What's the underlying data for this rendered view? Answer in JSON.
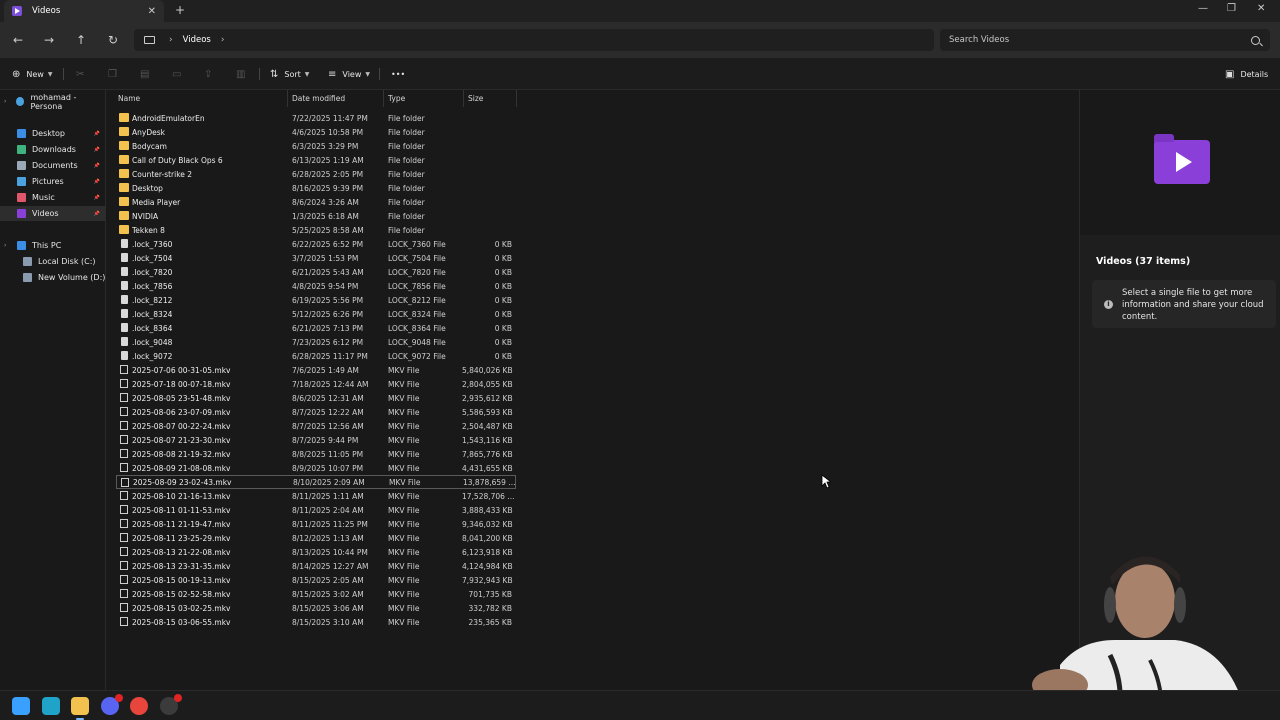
{
  "window": {
    "tab_label": "Videos",
    "tab_close": "✕",
    "new_tab": "+",
    "minimize": "—",
    "maximize": "❐",
    "close": "✕"
  },
  "nav": {
    "back": "←",
    "forward": "→",
    "up": "↑",
    "refresh": "↻",
    "breadcrumb_sep": "›",
    "location": "Videos",
    "search_placeholder": "Search Videos"
  },
  "toolbar": {
    "new_label": "New",
    "sort_label": "Sort",
    "view_label": "View",
    "more_label": "•••",
    "details_label": "Details"
  },
  "sidebar": {
    "account": "mohamad - Persona",
    "quick": [
      {
        "label": "Desktop",
        "color": "#3a8ee6"
      },
      {
        "label": "Downloads",
        "color": "#3fb37f"
      },
      {
        "label": "Documents",
        "color": "#9aa8b8"
      },
      {
        "label": "Pictures",
        "color": "#4aa3df"
      },
      {
        "label": "Music",
        "color": "#e0566b"
      },
      {
        "label": "Videos",
        "color": "#8b3fd9"
      }
    ],
    "this_pc": "This PC",
    "drives": [
      "Local Disk (C:)",
      "New Volume (D:)"
    ]
  },
  "columns": {
    "name": "Name",
    "date": "Date modified",
    "type": "Type",
    "size": "Size"
  },
  "files": [
    {
      "name": "AndroidEmulatorEn",
      "date": "7/22/2025 11:47 PM",
      "type": "File folder",
      "size": "",
      "kind": "folder"
    },
    {
      "name": "AnyDesk",
      "date": "4/6/2025 10:58 PM",
      "type": "File folder",
      "size": "",
      "kind": "folder"
    },
    {
      "name": "Bodycam",
      "date": "6/3/2025 3:29 PM",
      "type": "File folder",
      "size": "",
      "kind": "folder"
    },
    {
      "name": "Call of Duty  Black Ops 6",
      "date": "6/13/2025 1:19 AM",
      "type": "File folder",
      "size": "",
      "kind": "folder"
    },
    {
      "name": "Counter-strike 2",
      "date": "6/28/2025 2:05 PM",
      "type": "File folder",
      "size": "",
      "kind": "folder"
    },
    {
      "name": "Desktop",
      "date": "8/16/2025 9:39 PM",
      "type": "File folder",
      "size": "",
      "kind": "folder"
    },
    {
      "name": "Media Player",
      "date": "8/6/2024 3:26 AM",
      "type": "File folder",
      "size": "",
      "kind": "folder"
    },
    {
      "name": "NVIDIA",
      "date": "1/3/2025 6:18 AM",
      "type": "File folder",
      "size": "",
      "kind": "folder"
    },
    {
      "name": "Tekken 8",
      "date": "5/25/2025 8:58 AM",
      "type": "File folder",
      "size": "",
      "kind": "folder"
    },
    {
      "name": ".lock_7360",
      "date": "6/22/2025 6:52 PM",
      "type": "LOCK_7360 File",
      "size": "0 KB",
      "kind": "doc"
    },
    {
      "name": ".lock_7504",
      "date": "3/7/2025 1:53 PM",
      "type": "LOCK_7504 File",
      "size": "0 KB",
      "kind": "doc"
    },
    {
      "name": ".lock_7820",
      "date": "6/21/2025 5:43 AM",
      "type": "LOCK_7820 File",
      "size": "0 KB",
      "kind": "doc"
    },
    {
      "name": ".lock_7856",
      "date": "4/8/2025 9:54 PM",
      "type": "LOCK_7856 File",
      "size": "0 KB",
      "kind": "doc"
    },
    {
      "name": ".lock_8212",
      "date": "6/19/2025 5:56 PM",
      "type": "LOCK_8212 File",
      "size": "0 KB",
      "kind": "doc"
    },
    {
      "name": ".lock_8324",
      "date": "5/12/2025 6:26 PM",
      "type": "LOCK_8324 File",
      "size": "0 KB",
      "kind": "doc"
    },
    {
      "name": ".lock_8364",
      "date": "6/21/2025 7:13 PM",
      "type": "LOCK_8364 File",
      "size": "0 KB",
      "kind": "doc"
    },
    {
      "name": ".lock_9048",
      "date": "7/23/2025 6:12 PM",
      "type": "LOCK_9048 File",
      "size": "0 KB",
      "kind": "doc"
    },
    {
      "name": ".lock_9072",
      "date": "6/28/2025 11:17 PM",
      "type": "LOCK_9072 File",
      "size": "0 KB",
      "kind": "doc"
    },
    {
      "name": "2025-07-06 00-31-05.mkv",
      "date": "7/6/2025 1:49 AM",
      "type": "MKV File",
      "size": "5,840,026 KB",
      "kind": "vid"
    },
    {
      "name": "2025-07-18 00-07-18.mkv",
      "date": "7/18/2025 12:44 AM",
      "type": "MKV File",
      "size": "2,804,055 KB",
      "kind": "vid"
    },
    {
      "name": "2025-08-05 23-51-48.mkv",
      "date": "8/6/2025 12:31 AM",
      "type": "MKV File",
      "size": "2,935,612 KB",
      "kind": "vid"
    },
    {
      "name": "2025-08-06 23-07-09.mkv",
      "date": "8/7/2025 12:22 AM",
      "type": "MKV File",
      "size": "5,586,593 KB",
      "kind": "vid"
    },
    {
      "name": "2025-08-07 00-22-24.mkv",
      "date": "8/7/2025 12:56 AM",
      "type": "MKV File",
      "size": "2,504,487 KB",
      "kind": "vid"
    },
    {
      "name": "2025-08-07 21-23-30.mkv",
      "date": "8/7/2025 9:44 PM",
      "type": "MKV File",
      "size": "1,543,116 KB",
      "kind": "vid"
    },
    {
      "name": "2025-08-08 21-19-32.mkv",
      "date": "8/8/2025 11:05 PM",
      "type": "MKV File",
      "size": "7,865,776 KB",
      "kind": "vid"
    },
    {
      "name": "2025-08-09 21-08-08.mkv",
      "date": "8/9/2025 10:07 PM",
      "type": "MKV File",
      "size": "4,431,655 KB",
      "kind": "vid"
    },
    {
      "name": "2025-08-09 23-02-43.mkv",
      "date": "8/10/2025 2:09 AM",
      "type": "MKV File",
      "size": "13,878,659 ...",
      "kind": "vid"
    },
    {
      "name": "2025-08-10 21-16-13.mkv",
      "date": "8/11/2025 1:11 AM",
      "type": "MKV File",
      "size": "17,528,706 ...",
      "kind": "vid"
    },
    {
      "name": "2025-08-11 01-11-53.mkv",
      "date": "8/11/2025 2:04 AM",
      "type": "MKV File",
      "size": "3,888,433 KB",
      "kind": "vid"
    },
    {
      "name": "2025-08-11 21-19-47.mkv",
      "date": "8/11/2025 11:25 PM",
      "type": "MKV File",
      "size": "9,346,032 KB",
      "kind": "vid"
    },
    {
      "name": "2025-08-11 23-25-29.mkv",
      "date": "8/12/2025 1:13 AM",
      "type": "MKV File",
      "size": "8,041,200 KB",
      "kind": "vid"
    },
    {
      "name": "2025-08-13 21-22-08.mkv",
      "date": "8/13/2025 10:44 PM",
      "type": "MKV File",
      "size": "6,123,918 KB",
      "kind": "vid"
    },
    {
      "name": "2025-08-13 23-31-35.mkv",
      "date": "8/14/2025 12:27 AM",
      "type": "MKV File",
      "size": "4,124,984 KB",
      "kind": "vid"
    },
    {
      "name": "2025-08-15 00-19-13.mkv",
      "date": "8/15/2025 2:05 AM",
      "type": "MKV File",
      "size": "7,932,943 KB",
      "kind": "vid"
    },
    {
      "name": "2025-08-15 02-52-58.mkv",
      "date": "8/15/2025 3:02 AM",
      "type": "MKV File",
      "size": "701,735 KB",
      "kind": "vid"
    },
    {
      "name": "2025-08-15 03-02-25.mkv",
      "date": "8/15/2025 3:06 AM",
      "type": "MKV File",
      "size": "332,782 KB",
      "kind": "vid"
    },
    {
      "name": "2025-08-15 03-06-55.mkv",
      "date": "8/15/2025 3:10 AM",
      "type": "MKV File",
      "size": "235,365 KB",
      "kind": "vid"
    }
  ],
  "selected_index": 26,
  "details": {
    "title": "Videos (37 items)",
    "info_icon": "i",
    "info_text": "Select a single file to get more information and share your cloud content."
  },
  "taskbar": {
    "apps": [
      {
        "name": "start-button",
        "color": "#3aa0ff"
      },
      {
        "name": "edge-icon",
        "color": "#1fa3c9"
      },
      {
        "name": "file-explorer-icon",
        "color": "#f2c14e"
      },
      {
        "name": "discord-icon",
        "color": "#5865f2"
      },
      {
        "name": "chrome-icon",
        "color": "#e8453c"
      },
      {
        "name": "steam-icon",
        "color": "#3b3b3b"
      }
    ]
  }
}
